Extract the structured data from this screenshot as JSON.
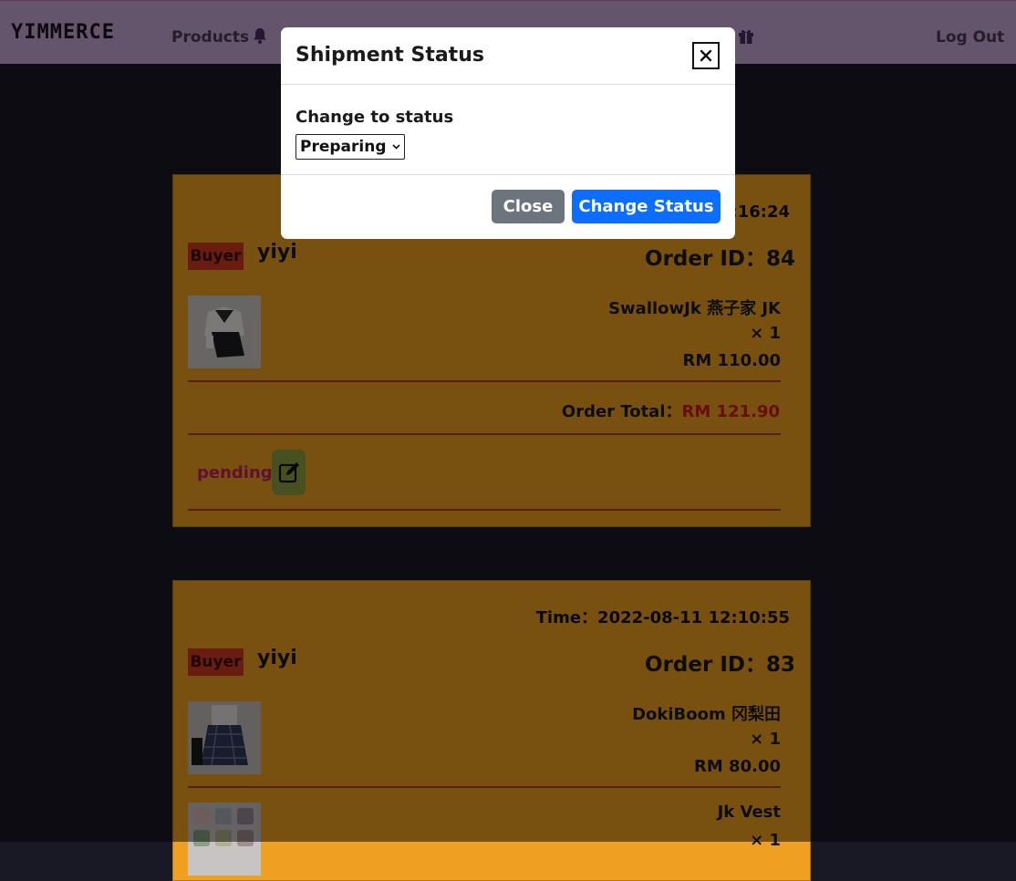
{
  "navbar": {
    "brand": "YIMMERCE",
    "products_label": "Products",
    "logout_label": "Log Out"
  },
  "orders": [
    {
      "time": "Time：2022-08-11 12:16:24",
      "buyer_badge": "Buyer",
      "buyer_name": "yiyi",
      "order_id": "Order ID：84",
      "items": [
        {
          "name": "SwallowJk 燕子家 JK",
          "qty": "× 1",
          "price": "RM 110.00"
        }
      ],
      "total_label": "Order Total：",
      "total_amount": "RM 121.90",
      "status": "pending"
    },
    {
      "time": "Time：2022-08-11 12:10:55",
      "buyer_badge": "Buyer",
      "buyer_name": "yiyi",
      "order_id": "Order ID：83",
      "items": [
        {
          "name": "DokiBoom 冈梨田",
          "qty": "× 1",
          "price": "RM 80.00"
        },
        {
          "name": "Jk Vest",
          "qty": "× 1",
          "price": ""
        }
      ]
    }
  ],
  "modal": {
    "title": "Shipment Status",
    "field_label": "Change to status",
    "selected_status": "Preparing",
    "close_label": "Close",
    "change_label": "Change Status"
  },
  "colors": {
    "navbar": "#c8a8d8",
    "card": "#f0a020",
    "buyer_badge": "#d03a20",
    "total_amount": "#d01818",
    "status_text": "#c02060",
    "edit_button": "#8fa040",
    "btn_close": "#6c757d",
    "btn_change": "#0d6efd"
  }
}
